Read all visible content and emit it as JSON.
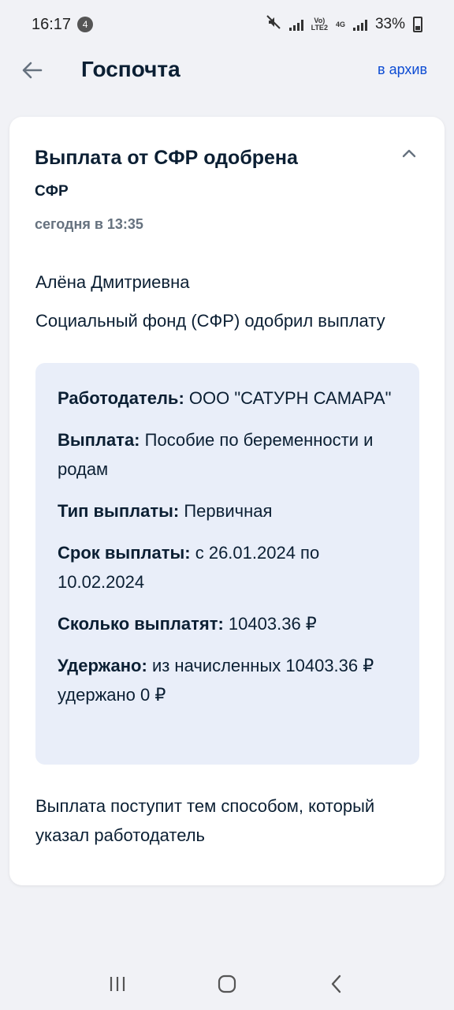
{
  "status_bar": {
    "time": "16:17",
    "notification_count": "4",
    "net_label_top": "Vo)",
    "net_label_bottom": "LTE2",
    "net_type": "4G",
    "battery_percent": "33%"
  },
  "header": {
    "title": "Госпочта",
    "archive_label": "в архив"
  },
  "message": {
    "title": "Выплата от СФР одобрена",
    "sender": "СФР",
    "date": "сегодня в 13:35",
    "greeting": "Алёна Дмитриевна",
    "intro": "Социальный фонд (СФР) одобрил выплату",
    "details": [
      {
        "label": "Работодатель:",
        "value": "ООО \"САТУРН САМАРА\""
      },
      {
        "label": "Выплата:",
        "value": "Пособие по беременности и родам"
      },
      {
        "label": "Тип выплаты:",
        "value": "Первичная"
      },
      {
        "label": "Срок выплаты:",
        "value": "с 26.01.2024 по 10.02.2024"
      },
      {
        "label": "Сколько выплатят:",
        "value": "10403.36 ₽"
      },
      {
        "label": "Удержано:",
        "value": "из начисленных 10403.36 ₽ удержано 0 ₽"
      }
    ],
    "footer": "Выплата поступит тем способом, который указал работодатель"
  },
  "colors": {
    "accent": "#0d4cd3",
    "info_box_bg": "#e9eef9",
    "text": "#0b1f33",
    "muted": "#66727f"
  },
  "icons": {
    "back": "arrow-left-icon",
    "collapse": "chevron-up-icon",
    "nav_recents": "recents-icon",
    "nav_home": "home-icon",
    "nav_back": "chevron-left-icon"
  }
}
